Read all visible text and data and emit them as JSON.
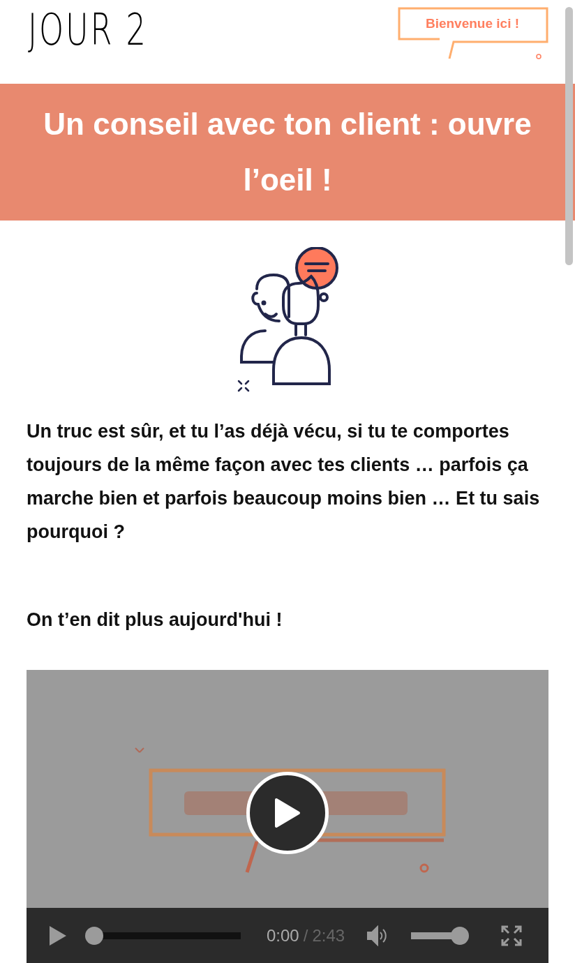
{
  "header": {
    "day": "JOUR 2",
    "logo": "Bienvenue ici !"
  },
  "banner": {
    "title": "Un conseil avec ton client : ouvre l’oeil !"
  },
  "paragraphs": [
    "Un truc est sûr, et tu l’as déjà vécu, si tu te comportes toujours de la même façon avec tes clients … parfois ça marche bien et parfois beaucoup moins bien … Et tu sais pourquoi ?",
    "On t’en dit plus aujourd'hui !"
  ],
  "video": {
    "kind": "picture",
    "playing": false,
    "progress": {
      "level": 0
    },
    "time": "0:00",
    "separator": "/",
    "duration": "2:43",
    "volume": {
      "level": 1
    }
  }
}
